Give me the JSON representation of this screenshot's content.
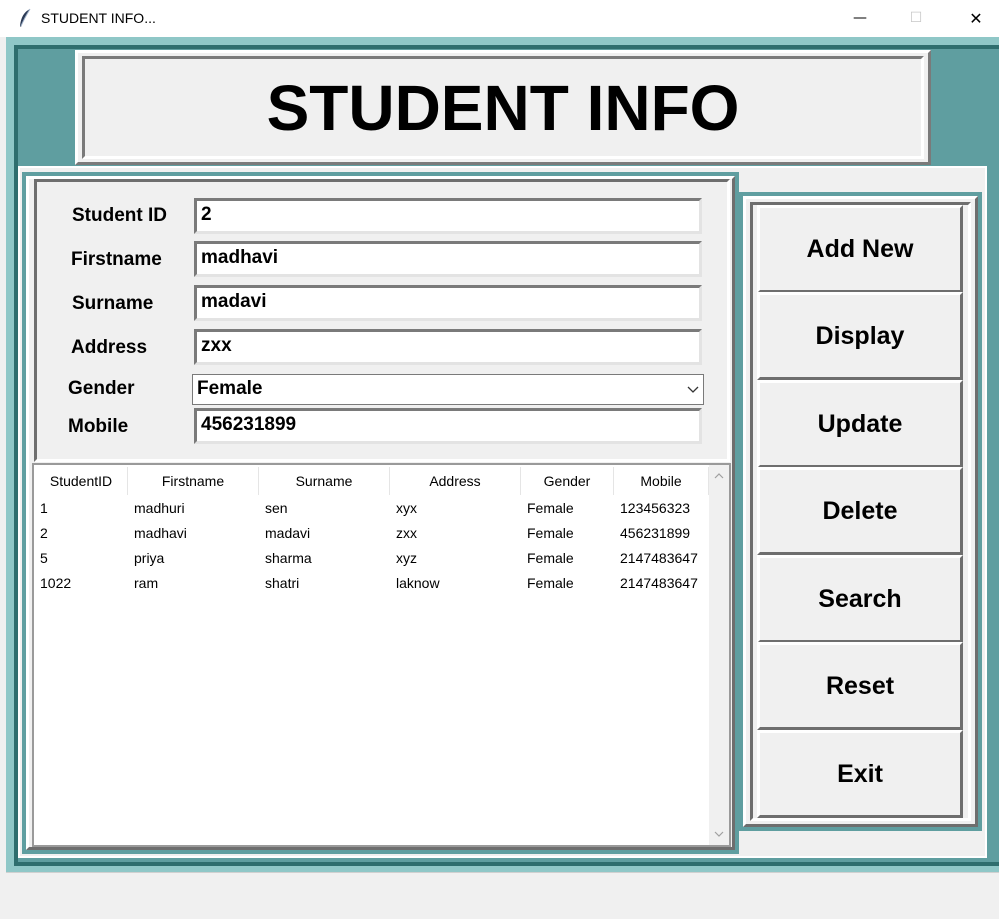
{
  "window": {
    "title": "STUDENT INFO...",
    "controls": {
      "minimize": "—",
      "maximize": "☐",
      "close": "✕"
    }
  },
  "header": {
    "title": "STUDENT INFO"
  },
  "form": {
    "fields": [
      {
        "label": "Student ID",
        "value": "2"
      },
      {
        "label": "Firstname",
        "value": "madhavi"
      },
      {
        "label": "Surname",
        "value": "madavi"
      },
      {
        "label": "Address",
        "value": "zxx"
      },
      {
        "label": "Gender",
        "value": "Female"
      },
      {
        "label": "Mobile",
        "value": "456231899"
      }
    ]
  },
  "table": {
    "columns": [
      "StudentID",
      "Firstname",
      "Surname",
      "Address",
      "Gender",
      "Mobile"
    ],
    "rows": [
      [
        "1",
        "madhuri",
        "sen",
        "xyx",
        "Female",
        "123456323"
      ],
      [
        "2",
        "madhavi",
        "madavi",
        "zxx",
        "Female",
        "456231899"
      ],
      [
        "5",
        "priya",
        "sharma",
        "xyz",
        "Female",
        "2147483647"
      ],
      [
        "1022",
        "ram",
        "shatri",
        "laknow",
        "Female",
        "2147483647"
      ]
    ]
  },
  "buttons": [
    "Add New",
    "Display",
    "Update",
    "Delete",
    "Search",
    "Reset",
    "Exit"
  ],
  "icons": {
    "app": "feather-icon",
    "dropdown": "chevron-down-icon",
    "scroll_up": "chevron-up-icon",
    "scroll_down": "chevron-down-icon"
  },
  "colors": {
    "frame_teal": "#5f9ea0",
    "frame_light": "#8fc7c7",
    "panel_gray": "#f0f0f0"
  }
}
